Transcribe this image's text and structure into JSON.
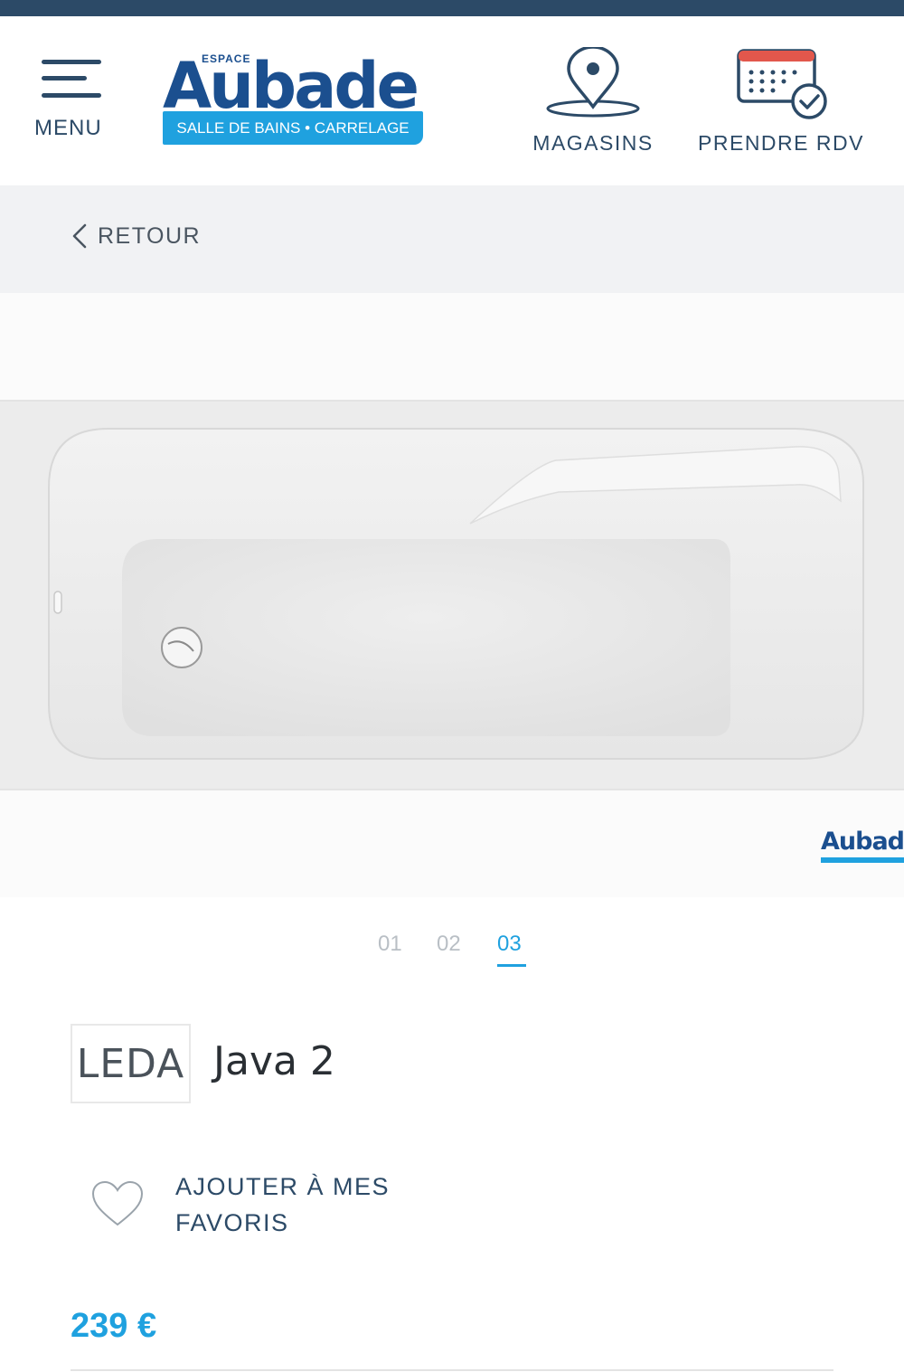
{
  "header": {
    "menu_label": "MENU",
    "logo": {
      "espace": "ESPACE",
      "name": "Aubade",
      "tagline": "SALLE DE BAINS • CARRELAGE"
    },
    "stores_label": "MAGASINS",
    "appointment_label": "PRENDRE RDV",
    "icons": {
      "menu": "hamburger-icon",
      "stores": "map-pin-icon",
      "appointment": "calendar-check-icon"
    }
  },
  "nav": {
    "back_label": "RETOUR"
  },
  "gallery": {
    "watermark": "Aubad",
    "pages": [
      "01",
      "02",
      "03"
    ],
    "active_page": "03"
  },
  "product": {
    "brand": "LEDA",
    "name": "Java 2",
    "favorite_label": "AJOUTER À MES FAVORIS",
    "price": "239 €"
  },
  "colors": {
    "navy": "#2c4a67",
    "accent_blue": "#1fa1df",
    "logo_blue": "#1b4f8f"
  }
}
